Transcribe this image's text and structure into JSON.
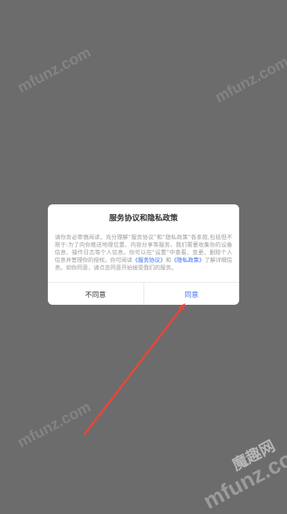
{
  "dialog": {
    "title": "服务协议和隐私政策",
    "body_part1": "请你务必审慎阅读，充分理解“服务协议”和“隐私政策”各条款,包括但不限于:为了向你推送地理位置、内容分享等服务，我们需要收集你的设备信息、操作日志等个人信息。你可以在“设置”中查看、变更、删除个人信息并管理你的授权。你可阅读",
    "link_service": "《服务协议》",
    "between_links": "和",
    "link_privacy": "《隐私政策》",
    "body_part2": "了解详细信息。如你同意，请点击同意开始接受我们的服务。",
    "disagree_label": "不同意",
    "agree_label": "同意"
  },
  "watermarks": {
    "wm1": "mfunz.com",
    "wm2": "mfunz.com",
    "wm3": "mfunz.com",
    "wm4": "mfunz.com",
    "wm_cn": "魔趣网"
  },
  "colors": {
    "overlay": "#6c6c6c",
    "link": "#3a6ff0",
    "arrow": "#e8463a"
  }
}
